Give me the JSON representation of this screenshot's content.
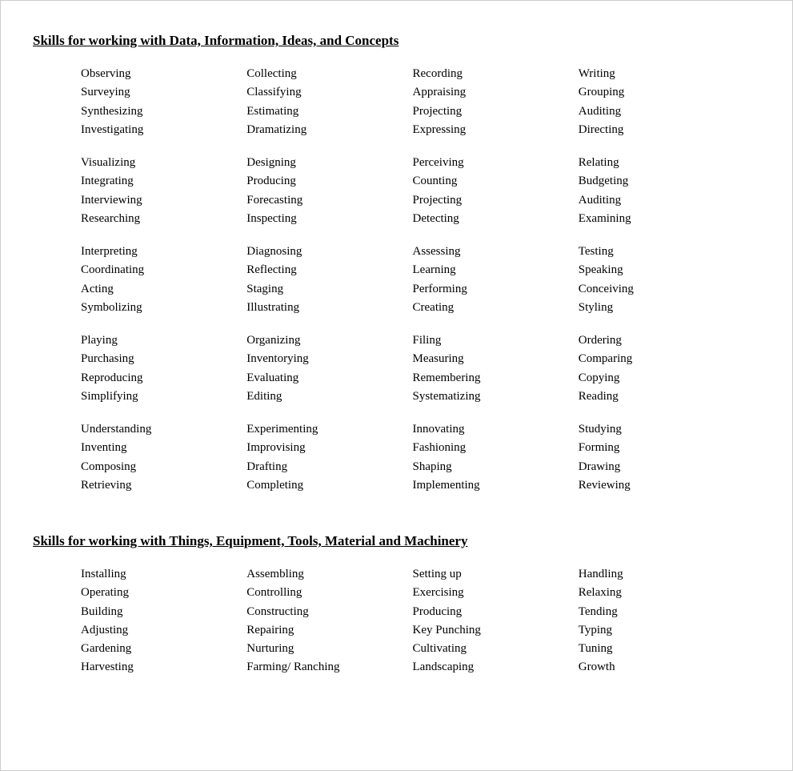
{
  "section1": {
    "title": "Skills for working with Data, Information, Ideas, and Concepts",
    "columns": [
      [
        [
          "Observing",
          "Surveying",
          "Synthesizing",
          "Investigating"
        ],
        [
          "Visualizing",
          "Integrating",
          "Interviewing",
          "Researching"
        ],
        [
          "Interpreting",
          "Coordinating",
          "Acting",
          "Symbolizing"
        ],
        [
          "Playing",
          "Purchasing",
          "Reproducing",
          "Simplifying"
        ],
        [
          "Understanding",
          "Inventing",
          "Composing",
          "Retrieving"
        ]
      ],
      [
        [
          "Collecting",
          "Classifying",
          "Estimating",
          "Dramatizing"
        ],
        [
          "Designing",
          "Producing",
          "Forecasting",
          "Inspecting"
        ],
        [
          "Diagnosing",
          "Reflecting",
          "Staging",
          "Illustrating"
        ],
        [
          "Organizing",
          "Inventorying",
          "Evaluating",
          "Editing"
        ],
        [
          "Experimenting",
          "Improvising",
          "Drafting",
          "Completing"
        ]
      ],
      [
        [
          "Recording",
          "Appraising",
          "Projecting",
          "Expressing"
        ],
        [
          "Perceiving",
          "Counting",
          "Projecting",
          "Detecting"
        ],
        [
          "Assessing",
          "Learning",
          "Performing",
          "Creating"
        ],
        [
          "Filing",
          "Measuring",
          "Remembering",
          "Systematizing"
        ],
        [
          "Innovating",
          "Fashioning",
          "Shaping",
          "Implementing"
        ]
      ],
      [
        [
          "Writing",
          "Grouping",
          "Auditing",
          "Directing"
        ],
        [
          "Relating",
          "Budgeting",
          "Auditing",
          "Examining"
        ],
        [
          "Testing",
          "Speaking",
          "Conceiving",
          "Styling"
        ],
        [
          "Ordering",
          "Comparing",
          "Copying",
          "Reading"
        ],
        [
          "Studying",
          "Forming",
          "Drawing",
          "Reviewing"
        ]
      ]
    ]
  },
  "section2": {
    "title": "Skills for working with Things, Equipment, Tools, Material and Machinery",
    "columns": [
      [
        [
          "Installing",
          "Operating",
          "Building",
          "Adjusting",
          "Gardening",
          "Harvesting"
        ]
      ],
      [
        [
          "Assembling",
          "Controlling",
          "Constructing",
          "Repairing",
          "Nurturing",
          "Farming/ Ranching"
        ]
      ],
      [
        [
          "Setting up",
          "Exercising",
          "Producing",
          "Key Punching",
          "Cultivating",
          "Landscaping"
        ]
      ],
      [
        [
          "Handling",
          "Relaxing",
          "Tending",
          "Typing",
          "Tuning",
          "Growth"
        ]
      ]
    ]
  }
}
